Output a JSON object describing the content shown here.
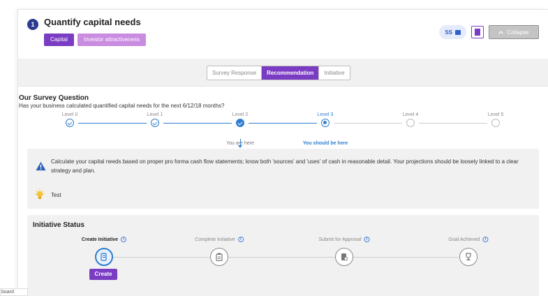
{
  "header": {
    "step_number": "1",
    "title": "Quantify capital needs",
    "tags": [
      "Capital",
      "Investor attractiveness"
    ],
    "ss_label": "SS",
    "collapse_label": "Collapse"
  },
  "tabs": [
    {
      "label": "Survey Response",
      "active": false
    },
    {
      "label": "Recommendation",
      "active": true
    },
    {
      "label": "Initiative",
      "active": false
    }
  ],
  "survey": {
    "title": "Our Survey Question",
    "question": "Has your business calculated quantified capital needs for the next 6/12/18 months?",
    "levels": [
      "Level 0",
      "Level 1",
      "Level 2",
      "Level 3",
      "Level 4",
      "Level 5"
    ],
    "you_are_here": "You are here",
    "you_should_be_here": "You should be here"
  },
  "recommendation": {
    "text": "Calculate your capital needs based on proper pro forma cash flow statements; know both 'sources' and 'uses' of cash in reasonable detail. Your projections should be loosely linked to a clear strategy and plan."
  },
  "note": {
    "text": "Test"
  },
  "initiative_status": {
    "title": "Initiative Status",
    "steps": [
      "Create Initiative",
      "Complete Initiative",
      "Submit for Approval",
      "Goal Achieved"
    ],
    "info_glyph": "i",
    "create_label": "Create"
  },
  "footer": {
    "partial_label": "board"
  },
  "colors": {
    "accent": "#7b3cc4",
    "accent_light": "#c98ce0",
    "blue": "#2e7dd1",
    "navy": "#2b3a8f"
  }
}
